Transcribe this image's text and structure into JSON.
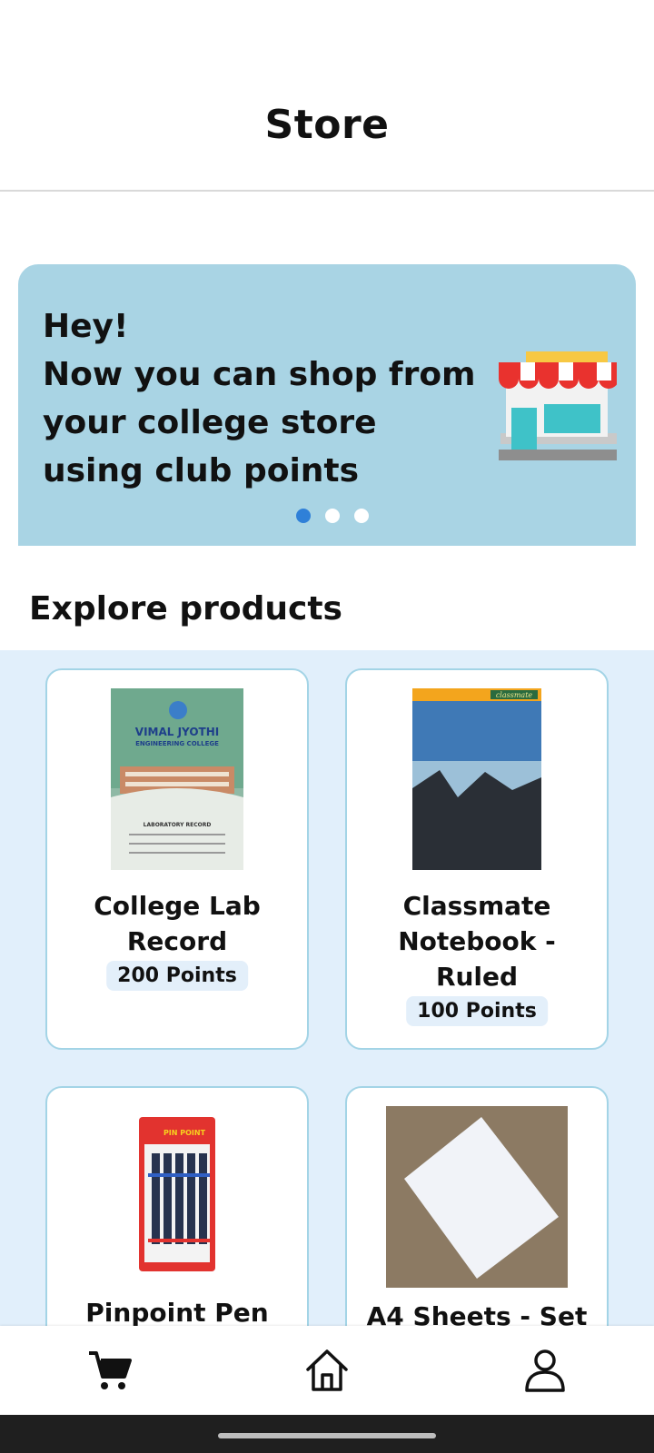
{
  "header": {
    "title": "Store"
  },
  "banner": {
    "lines": [
      "Hey!",
      "Now you can shop from",
      "your college store",
      "using club points"
    ],
    "active_slide": 1,
    "slide_count": 3,
    "icon": "store-front-icon"
  },
  "section": {
    "title": "Explore products"
  },
  "products": [
    {
      "name_lines": [
        "College Lab",
        "Record"
      ],
      "points": "200 Points",
      "image_text": [
        "VIMAL JYOTHI",
        "ENGINEERING COLLEGE",
        "LABORATORY RECORD"
      ]
    },
    {
      "name_lines": [
        "Classmate",
        "Notebook -",
        "Ruled"
      ],
      "points": "100 Points",
      "image_text": [
        "classmate"
      ]
    },
    {
      "name_lines": [
        "Pinpoint Pen"
      ],
      "points": "",
      "image_text": [
        "PIN POINT"
      ]
    },
    {
      "name_lines": [
        "A4 Sheets - Set"
      ],
      "points": "",
      "image_text": []
    }
  ],
  "bottom_nav": {
    "items": [
      {
        "icon": "cart-icon"
      },
      {
        "icon": "home-icon"
      },
      {
        "icon": "profile-icon"
      }
    ]
  },
  "colors": {
    "banner_bg": "#a9d4e4",
    "products_bg": "#e1effb",
    "card_border": "#a3d4e6",
    "dot_active": "#2f80d8",
    "points_bg": "#e3effa"
  }
}
